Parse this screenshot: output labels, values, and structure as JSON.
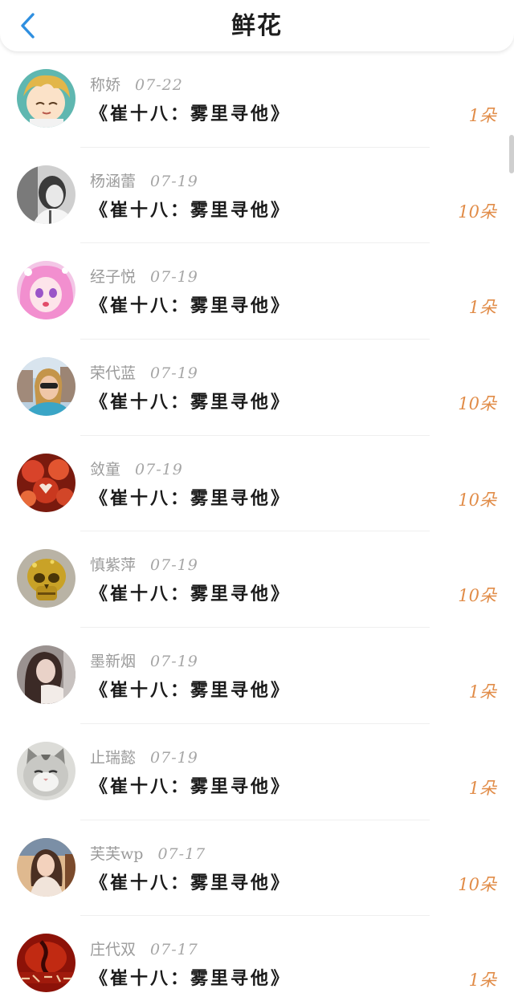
{
  "header": {
    "title": "鲜花"
  },
  "colors": {
    "accent_back": "#2f8fe0",
    "count": "#e18c48"
  },
  "list": {
    "items": [
      {
        "name": "称娇",
        "date": "07-22",
        "title": "《崔十八：雾里寻他》",
        "count": "1朵",
        "avatar": "anime-boy-avatar"
      },
      {
        "name": "杨涵蕾",
        "date": "07-19",
        "title": "《崔十八：雾里寻他》",
        "count": "10朵",
        "avatar": "monochrome-portrait-avatar"
      },
      {
        "name": "经子悦",
        "date": "07-19",
        "title": "《崔十八：雾里寻他》",
        "count": "1朵",
        "avatar": "anime-girl-avatar"
      },
      {
        "name": "荣代蓝",
        "date": "07-19",
        "title": "《崔十八：雾里寻他》",
        "count": "10朵",
        "avatar": "sunglasses-selfie-avatar"
      },
      {
        "name": "敛童",
        "date": "07-19",
        "title": "《崔十八：雾里寻他》",
        "count": "10朵",
        "avatar": "red-flowers-avatar"
      },
      {
        "name": "慎紫萍",
        "date": "07-19",
        "title": "《崔十八：雾里寻他》",
        "count": "10朵",
        "avatar": "golden-skull-avatar"
      },
      {
        "name": "墨新烟",
        "date": "07-19",
        "title": "《崔十八：雾里寻他》",
        "count": "1朵",
        "avatar": "woman-portrait-avatar"
      },
      {
        "name": "止瑞懿",
        "date": "07-19",
        "title": "《崔十八：雾里寻他》",
        "count": "1朵",
        "avatar": "cat-avatar"
      },
      {
        "name": "芙芙wp",
        "date": "07-17",
        "title": "《崔十八：雾里寻他》",
        "count": "10朵",
        "avatar": "girl-photo-avatar"
      },
      {
        "name": "庄代双",
        "date": "07-17",
        "title": "《崔十八：雾里寻他》",
        "count": "1朵",
        "avatar": "red-calligraphy-avatar"
      }
    ]
  }
}
